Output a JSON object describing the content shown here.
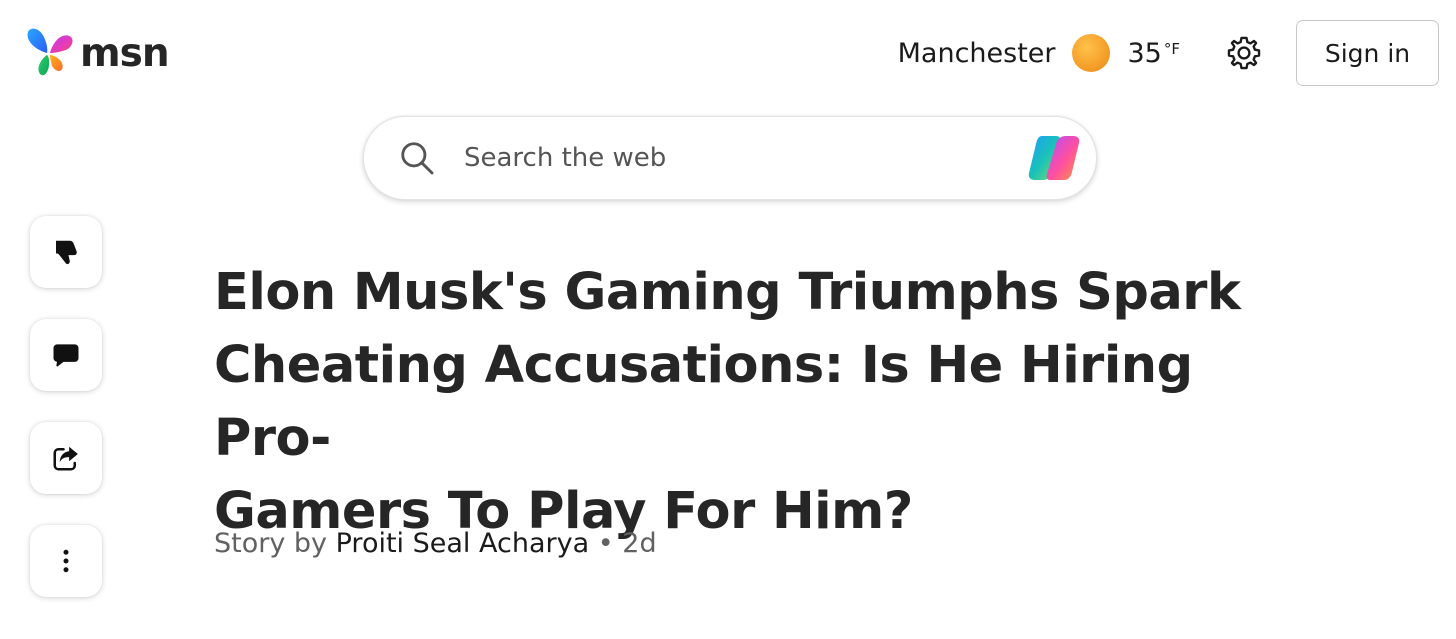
{
  "header": {
    "logo_text": "msn",
    "location": "Manchester",
    "weather_icon": "sun-icon",
    "temperature": "35",
    "temperature_unit": "°F",
    "settings_icon": "gear-icon",
    "signin_label": "Sign in"
  },
  "search": {
    "placeholder": "Search the web",
    "value": "",
    "search_icon": "search-icon",
    "assistant_icon": "copilot-icon"
  },
  "sidebar": {
    "actions": [
      {
        "name": "dislike",
        "icon": "thumbs-down-icon"
      },
      {
        "name": "comments",
        "icon": "comment-icon"
      },
      {
        "name": "share",
        "icon": "share-icon"
      },
      {
        "name": "more",
        "icon": "more-vertical-icon"
      }
    ]
  },
  "article": {
    "title_lines": [
      "Elon Musk's Gaming Triumphs Spark",
      "Cheating Accusations: Is He Hiring Pro-",
      "Gamers To Play For Him?"
    ],
    "byline_prefix": "Story by",
    "author": "Proiti Seal Acharya",
    "separator": "•",
    "age": "2d"
  },
  "colors": {
    "weather_sun": "#f6a12c",
    "text_primary": "#262626",
    "text_secondary": "#616161"
  }
}
